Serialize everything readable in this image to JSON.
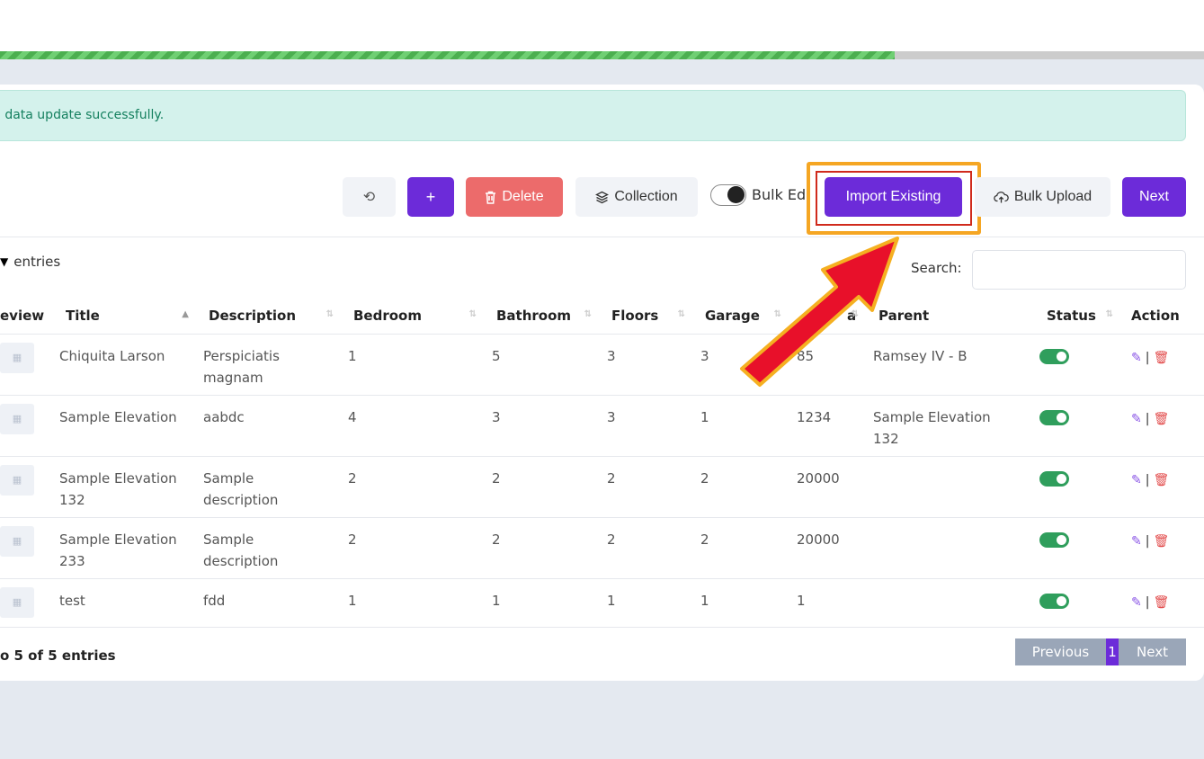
{
  "progress": {
    "fraction": 0.743
  },
  "alert": {
    "text": "n data update successfully."
  },
  "toolbar": {
    "undo_icon": "⟲",
    "add_label": "+",
    "delete_label": "Delete",
    "collection_label": "Collection",
    "bulk_edit_label": "Bulk Edi",
    "import_label": "Import Existing",
    "bulk_upload_label": "Bulk Upload",
    "next_label": "Next"
  },
  "table_controls": {
    "entries_label": "entries",
    "search_label": "Search:"
  },
  "columns": [
    "eview",
    "Title",
    "Description",
    "Bedroom",
    "Bathroom",
    "Floors",
    "Garage",
    "a",
    "Parent",
    "Status",
    "Action"
  ],
  "rows": [
    {
      "title": "Chiquita Larson",
      "description": "Perspiciatis magnam",
      "bedroom": "1",
      "bathroom": "5",
      "floors": "3",
      "garage": "3",
      "area": "85",
      "parent": "Ramsey IV - B"
    },
    {
      "title": "Sample Elevation",
      "description": "aabdc",
      "bedroom": "4",
      "bathroom": "3",
      "floors": "3",
      "garage": "1",
      "area": "1234",
      "parent": "Sample Elevation 132"
    },
    {
      "title": "Sample Elevation 132",
      "description": "Sample description",
      "bedroom": "2",
      "bathroom": "2",
      "floors": "2",
      "garage": "2",
      "area": "20000",
      "parent": ""
    },
    {
      "title": "Sample Elevation 233",
      "description": "Sample description",
      "bedroom": "2",
      "bathroom": "2",
      "floors": "2",
      "garage": "2",
      "area": "20000",
      "parent": ""
    },
    {
      "title": "test",
      "description": "fdd",
      "bedroom": "1",
      "bathroom": "1",
      "floors": "1",
      "garage": "1",
      "area": "1",
      "parent": ""
    }
  ],
  "footer": {
    "info": "o 5 of 5 entries",
    "prev_label": "Previous",
    "page": "1",
    "next_label": "Next"
  },
  "colors": {
    "accent": "#6c2bd9",
    "danger": "#ec6b6b",
    "success": "#2f9e5c",
    "highlight": "#f5a623",
    "arrow": "#e8102a"
  }
}
